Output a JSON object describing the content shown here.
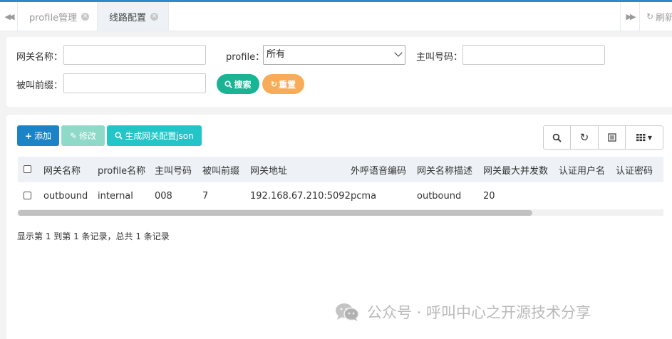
{
  "tabs": {
    "tab1_label": "profile管理",
    "tab2_label": "线路配置",
    "close_glyph": "×",
    "refresh_label": "刷新"
  },
  "search": {
    "gateway_name_label": "网关名称：",
    "profile_label": "profile：",
    "profile_selected": "所有",
    "caller_label": "主叫号码：",
    "callee_prefix_label": "被叫前缀：",
    "search_button": "搜索",
    "reset_button": "重置"
  },
  "toolbar": {
    "add_label": "添加",
    "edit_label": "修改",
    "generate_label": "生成网关配置json"
  },
  "table": {
    "columns": [
      "网关名称",
      "profile名称",
      "主叫号码",
      "被叫前缀",
      "网关地址",
      "外呼语音编码",
      "网关名称描述",
      "网关最大并发数",
      "认证用户名",
      "认证密码"
    ],
    "rows": [
      [
        "outbound",
        "internal",
        "008",
        "7",
        "192.168.67.210:5092",
        "pcma",
        "outbound",
        "20",
        "",
        ""
      ]
    ]
  },
  "pagination": {
    "info": "显示第 1 到第 1 条记录，总共 1 条记录"
  },
  "watermark": {
    "text": "公众号 · 呼叫中心之开源技术分享"
  },
  "colors": {
    "primary_blue": "#1c84c6",
    "success_green": "#1ab394",
    "warning_orange": "#f8ac59",
    "info_cyan": "#23c6c8",
    "top_accent": "#2f88c9"
  }
}
